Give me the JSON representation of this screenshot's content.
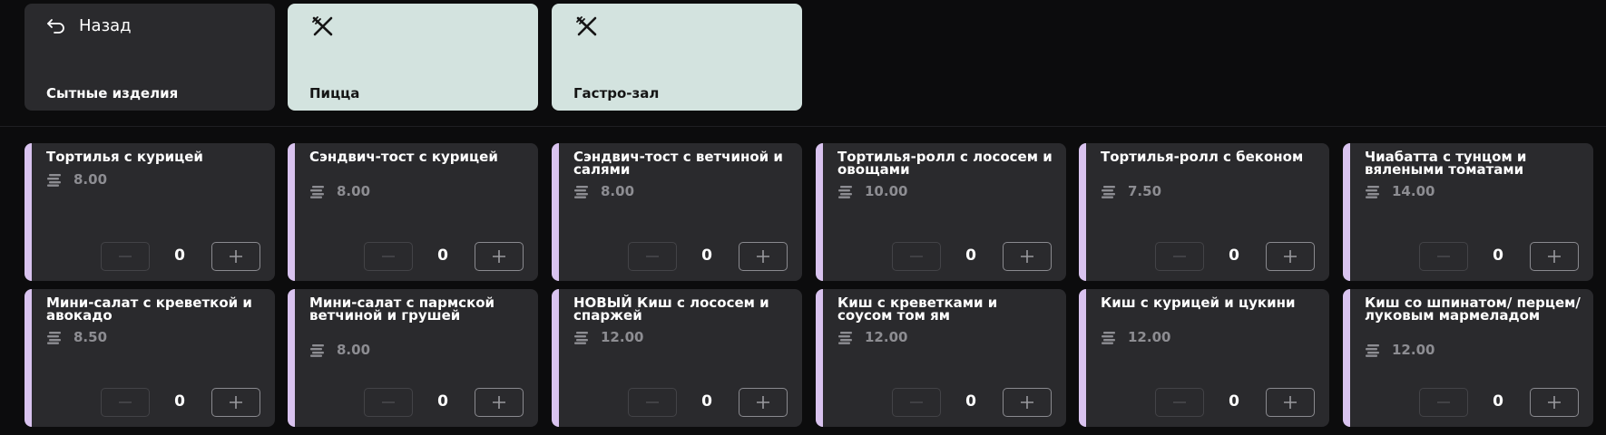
{
  "nav": {
    "back_label": "Назад",
    "current_category": "Сытные изделия",
    "categories": [
      {
        "label": "Пицца"
      },
      {
        "label": "Гастро-зал"
      }
    ]
  },
  "colors": {
    "background": "#0c0c0d",
    "card": "#2a2a2d",
    "category_tile": "#d3e3df",
    "accent": "#d9c3ef",
    "price_text": "#8d8d92"
  },
  "products": [
    {
      "title": "Тортилья с курицей",
      "price": "8.00",
      "quantity": "0"
    },
    {
      "title": "Сэндвич-тост с курицей",
      "price": "8.00",
      "quantity": "0"
    },
    {
      "title": "Сэндвич-тост с ветчиной и салями",
      "price": "8.00",
      "quantity": "0"
    },
    {
      "title": "Тортилья-ролл с лососем и овощами",
      "price": "10.00",
      "quantity": "0"
    },
    {
      "title": "Тортилья-ролл с беконом",
      "price": "7.50",
      "quantity": "0"
    },
    {
      "title": "Чиабатта с тунцом и вялеными томатами",
      "price": "14.00",
      "quantity": "0"
    },
    {
      "title": "Мини-салат с креветкой и авокадо",
      "price": "8.50",
      "quantity": "0"
    },
    {
      "title": "Мини-салат с пармской ветчиной и грушей",
      "price": "8.00",
      "quantity": "0"
    },
    {
      "title": "НОВЫЙ Киш с лососем и спаржей",
      "price": "12.00",
      "quantity": "0"
    },
    {
      "title": "Киш с креветками и соусом том ям",
      "price": "12.00",
      "quantity": "0"
    },
    {
      "title": "Киш с курицей и цукини",
      "price": "12.00",
      "quantity": "0"
    },
    {
      "title": "Киш со шпинатом/ перцем/луковым мармеладом",
      "price": "12.00",
      "quantity": "0"
    }
  ]
}
